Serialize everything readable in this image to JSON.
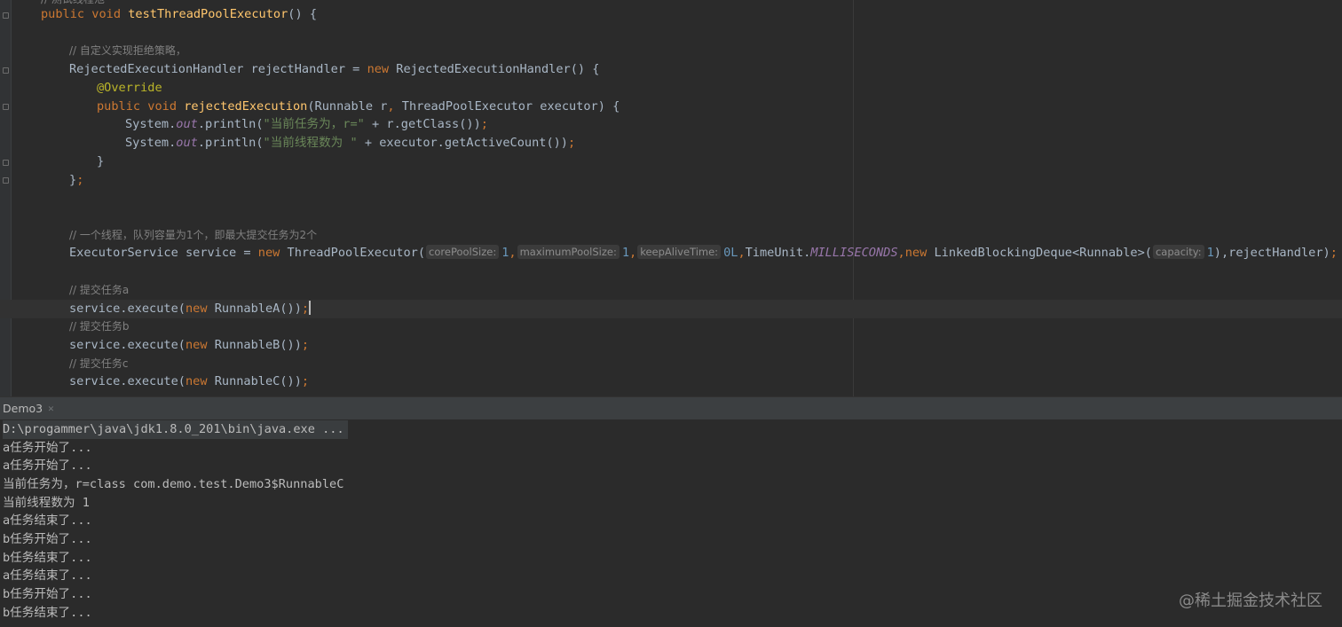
{
  "editor": {
    "line0_comment": "// 测试线程池",
    "line1": {
      "kw": "public void ",
      "fn": "testThreadPoolExecutor",
      "rest": "() {"
    },
    "line3_comment": "// 自定义实现拒绝策略，",
    "line4": {
      "a": "RejectedExecutionHandler rejectHandler = ",
      "kw": "new",
      "b": " RejectedExecutionHandler() {"
    },
    "line5_annotation": "@Override",
    "line6": {
      "kw": "public void ",
      "fn": "rejectedExecution",
      "a": "(Runnable r",
      "comma": ",",
      "b": " ThreadPoolExecutor executor) {"
    },
    "line7": {
      "a": "System.",
      "out": "out",
      "b": ".println(",
      "str": "\"当前任务为，r=\"",
      "c": " + r.getClass())",
      "semi": ";"
    },
    "line8": {
      "a": "System.",
      "out": "out",
      "b": ".println(",
      "str": "\"当前线程数为 \"",
      "c": " + executor.getActiveCount())",
      "semi": ";"
    },
    "line9": "}",
    "line10": {
      "a": "}",
      "semi": ";"
    },
    "line13_comment": "// 一个线程，队列容量为1个，即最大提交任务为2个",
    "line14": {
      "a": "ExecutorService service = ",
      "kw1": "new",
      "b": " ThreadPoolExecutor(",
      "hint1": "corePoolSize:",
      "n1": "1",
      "comma1": ",",
      "hint2": "maximumPoolSize:",
      "n2": "1",
      "comma2": ",",
      "hint3": "keepAliveTime:",
      "n3": "0L",
      "comma3": ",",
      "c": "TimeUnit.",
      "ms": "MILLISECONDS",
      "comma4": ",",
      "kw2": "new",
      "d": " LinkedBlockingDeque<Runnable>(",
      "hint4": "capacity:",
      "n4": "1",
      "e": "),rejectHandler)",
      "semi": ";"
    },
    "line16_comment": "// 提交任务a",
    "line17": {
      "a": "service.execute(",
      "kw": "new",
      "b": " RunnableA())",
      "semi": ";"
    },
    "line18_comment": "// 提交任务b",
    "line19": {
      "a": "service.execute(",
      "kw": "new",
      "b": " RunnableB())",
      "semi": ";"
    },
    "line20_comment": "// 提交任务c",
    "line21": {
      "a": "service.execute(",
      "kw": "new",
      "b": " RunnableC())",
      "semi": ";"
    }
  },
  "run_tab": {
    "label": "Demo3",
    "close_icon": "close-icon"
  },
  "console": {
    "command": "D:\\progammer\\java\\jdk1.8.0_201\\bin\\java.exe ...",
    "lines": [
      "a任务开始了...",
      "a任务开始了...",
      "当前任务为，r=class com.demo.test.Demo3$RunnableC",
      "当前线程数为 1",
      "a任务结束了...",
      "b任务开始了...",
      "b任务结束了...",
      "a任务结束了...",
      "b任务开始了...",
      "b任务结束了..."
    ]
  },
  "watermark": "@稀土掘金技术社区",
  "colors": {
    "background": "#2b2b2b",
    "keyword": "#cc7832",
    "function": "#ffc66d",
    "string": "#6a8759",
    "comment": "#808080",
    "annotation": "#bbb529",
    "static_field": "#9876aa",
    "number": "#6897bb",
    "text": "#a9b7c6"
  }
}
